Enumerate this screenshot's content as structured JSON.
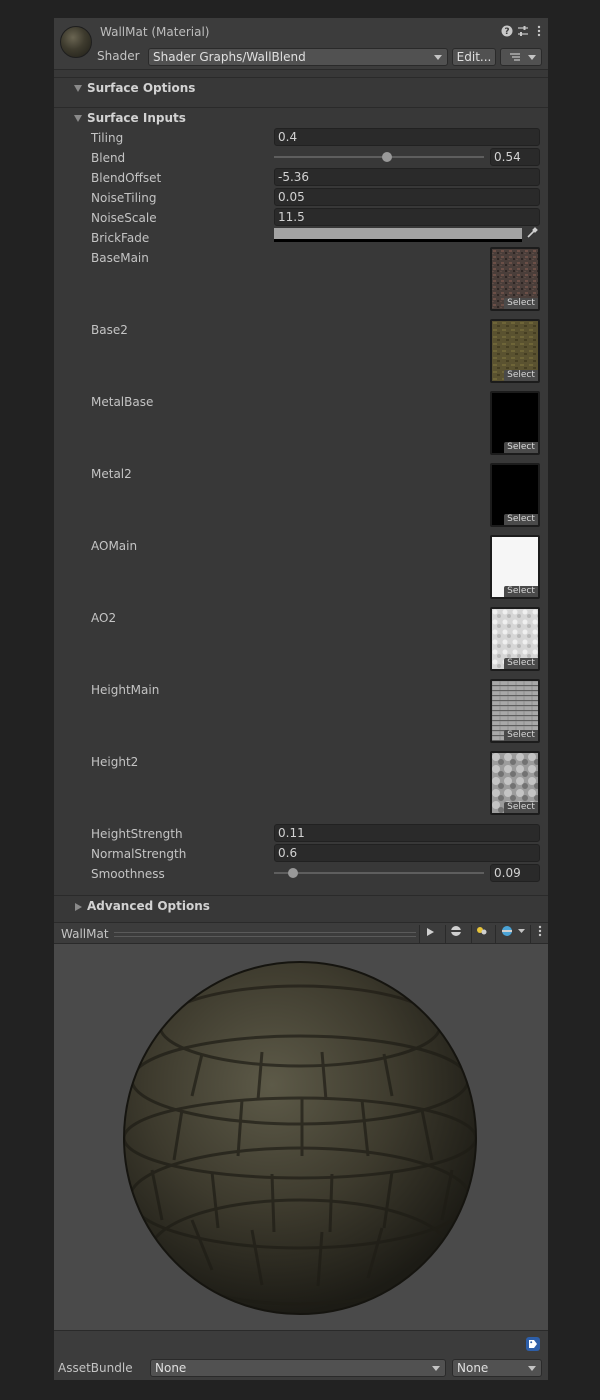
{
  "header": {
    "title": "WallMat (Material)",
    "shader_label": "Shader",
    "shader_value": "Shader Graphs/WallBlend",
    "edit_label": "Edit...",
    "icons": [
      "help-icon",
      "preset-icon",
      "kebab-menu-icon"
    ]
  },
  "sections": {
    "surface_options": "Surface Options",
    "surface_inputs": "Surface Inputs",
    "advanced_options": "Advanced Options"
  },
  "properties": {
    "tiling": {
      "label": "Tiling",
      "value": "0.4"
    },
    "blend": {
      "label": "Blend",
      "value": "0.54",
      "fraction": 0.54
    },
    "blend_offset": {
      "label": "BlendOffset",
      "value": "-5.36"
    },
    "noise_tiling": {
      "label": "NoiseTiling",
      "value": "0.05"
    },
    "noise_scale": {
      "label": "NoiseScale",
      "value": "11.5"
    },
    "brick_fade": {
      "label": "BrickFade",
      "color": "#a3a3a3"
    },
    "height_strength": {
      "label": "HeightStrength",
      "value": "0.11"
    },
    "normal_strength": {
      "label": "NormalStrength",
      "value": "0.6"
    },
    "smoothness": {
      "label": "Smoothness",
      "value": "0.09",
      "fraction": 0.09
    }
  },
  "textures": [
    {
      "label": "BaseMain",
      "select": "Select"
    },
    {
      "label": "Base2",
      "select": "Select"
    },
    {
      "label": "MetalBase",
      "select": "Select"
    },
    {
      "label": "Metal2",
      "select": "Select"
    },
    {
      "label": "AOMain",
      "select": "Select"
    },
    {
      "label": "AO2",
      "select": "Select"
    },
    {
      "label": "HeightMain",
      "select": "Select"
    },
    {
      "label": "Height2",
      "select": "Select"
    }
  ],
  "preview": {
    "name": "WallMat"
  },
  "asset_bundle": {
    "label": "AssetBundle",
    "bundle_value": "None",
    "variant_value": "None"
  }
}
